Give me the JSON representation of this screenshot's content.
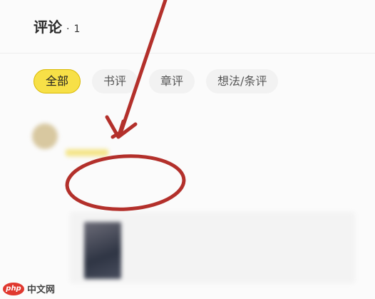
{
  "header": {
    "title": "评论",
    "separator": "·",
    "count": "1"
  },
  "tabs": [
    {
      "label": "全部",
      "active": true
    },
    {
      "label": "书评",
      "active": false
    },
    {
      "label": "章评",
      "active": false
    },
    {
      "label": "想法/条评",
      "active": false
    }
  ],
  "colors": {
    "active_tab": "#f7e047",
    "annotation": "#b3302b"
  },
  "watermark": {
    "logo": "php",
    "text": "中文网"
  }
}
